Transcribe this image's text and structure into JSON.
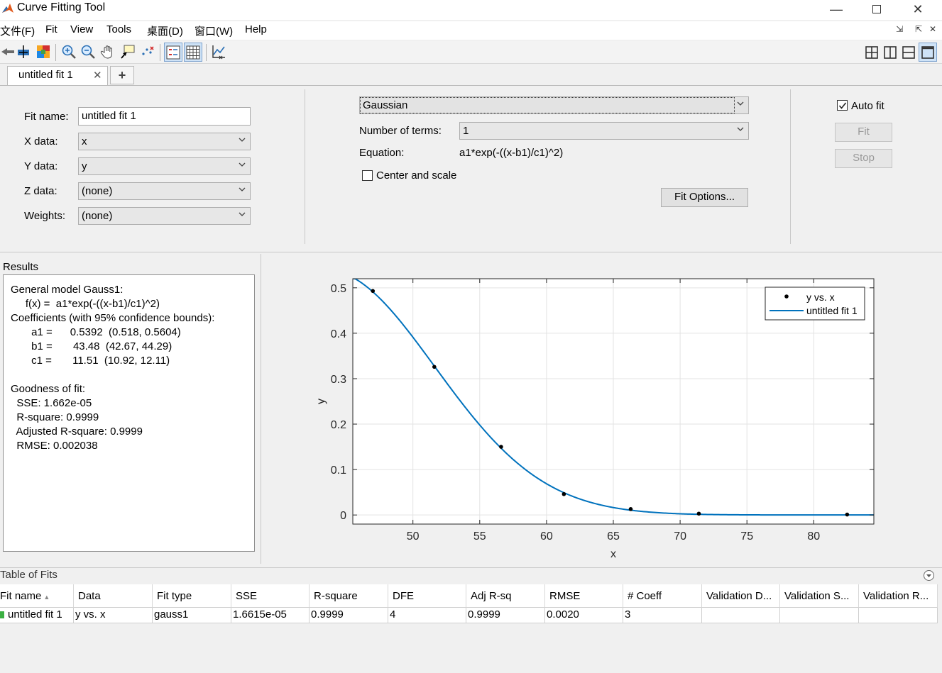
{
  "window": {
    "title": "Curve Fitting Tool"
  },
  "menu": [
    "文件(F)",
    "Fit",
    "View",
    "Tools",
    "桌面(D)",
    "窗口(W)",
    "Help"
  ],
  "tabs": {
    "active": "untitled fit 1",
    "close_glyph": "✕",
    "add_glyph": "+"
  },
  "data_selection": {
    "fit_name_label": "Fit name:",
    "fit_name_value": "untitled fit 1",
    "x_label": "X data:",
    "x_value": "x",
    "y_label": "Y data:",
    "y_value": "y",
    "z_label": "Z data:",
    "z_value": "(none)",
    "w_label": "Weights:",
    "w_value": "(none)"
  },
  "fit_settings": {
    "model": "Gaussian",
    "terms_label": "Number of terms:",
    "terms_value": "1",
    "equation_label": "Equation:",
    "equation_value": "a1*exp(-((x-b1)/c1)^2)",
    "center_scale_label": "Center and scale",
    "center_scale_checked": false,
    "fit_options_button": "Fit Options..."
  },
  "auto_fit": {
    "label": "Auto fit",
    "checked": true,
    "fit_button": "Fit",
    "stop_button": "Stop"
  },
  "results": {
    "title": "Results",
    "lines": [
      "General model Gauss1:",
      "     f(x) =  a1*exp(-((x-b1)/c1)^2)",
      "Coefficients (with 95% confidence bounds):",
      "       a1 =      0.5392  (0.518, 0.5604)",
      "       b1 =       43.48  (42.67, 44.29)",
      "       c1 =       11.51  (10.92, 12.11)",
      "",
      "Goodness of fit:",
      "  SSE: 1.662e-05",
      "  R-square: 0.9999",
      "  Adjusted R-square: 0.9999",
      "  RMSE: 0.002038"
    ]
  },
  "chart_data": {
    "type": "scatter",
    "xlabel": "x",
    "ylabel": "y",
    "xlim": [
      45.5,
      84.5
    ],
    "ylim": [
      -0.02,
      0.52
    ],
    "xticks": [
      "50",
      "55",
      "60",
      "65",
      "70",
      "75",
      "80"
    ],
    "yticks": [
      "0",
      "0.1",
      "0.2",
      "0.3",
      "0.4",
      "0.5"
    ],
    "grid": true,
    "legend": {
      "placement": "top-right",
      "entries": [
        "y vs. x",
        "untitled fit 1"
      ]
    },
    "series": [
      {
        "name": "y vs. x",
        "kind": "points",
        "x": [
          47.0,
          51.6,
          56.6,
          61.3,
          66.3,
          71.4,
          82.5
        ],
        "y": [
          0.493,
          0.326,
          0.15,
          0.046,
          0.013,
          0.003,
          0.001
        ]
      },
      {
        "name": "untitled fit 1",
        "kind": "curve",
        "model": "gauss1",
        "a1": 0.5392,
        "b1": 43.48,
        "c1": 11.51
      }
    ],
    "colors": {
      "fit_line": "#0072BD",
      "points": "#000000"
    }
  },
  "table_of_fits": {
    "title": "Table of Fits",
    "columns": [
      "Fit name",
      "Data",
      "Fit type",
      "SSE",
      "R-square",
      "DFE",
      "Adj R-sq",
      "RMSE",
      "# Coeff",
      "Validation D...",
      "Validation S...",
      "Validation R..."
    ],
    "sort_glyph": "▲",
    "rows": [
      [
        "untitled fit 1",
        "y vs. x",
        "gauss1",
        "1.6615e-05",
        "0.9999",
        "4",
        "0.9999",
        "0.0020",
        "3",
        "",
        "",
        ""
      ]
    ],
    "row_status_color": "#3cb043"
  }
}
